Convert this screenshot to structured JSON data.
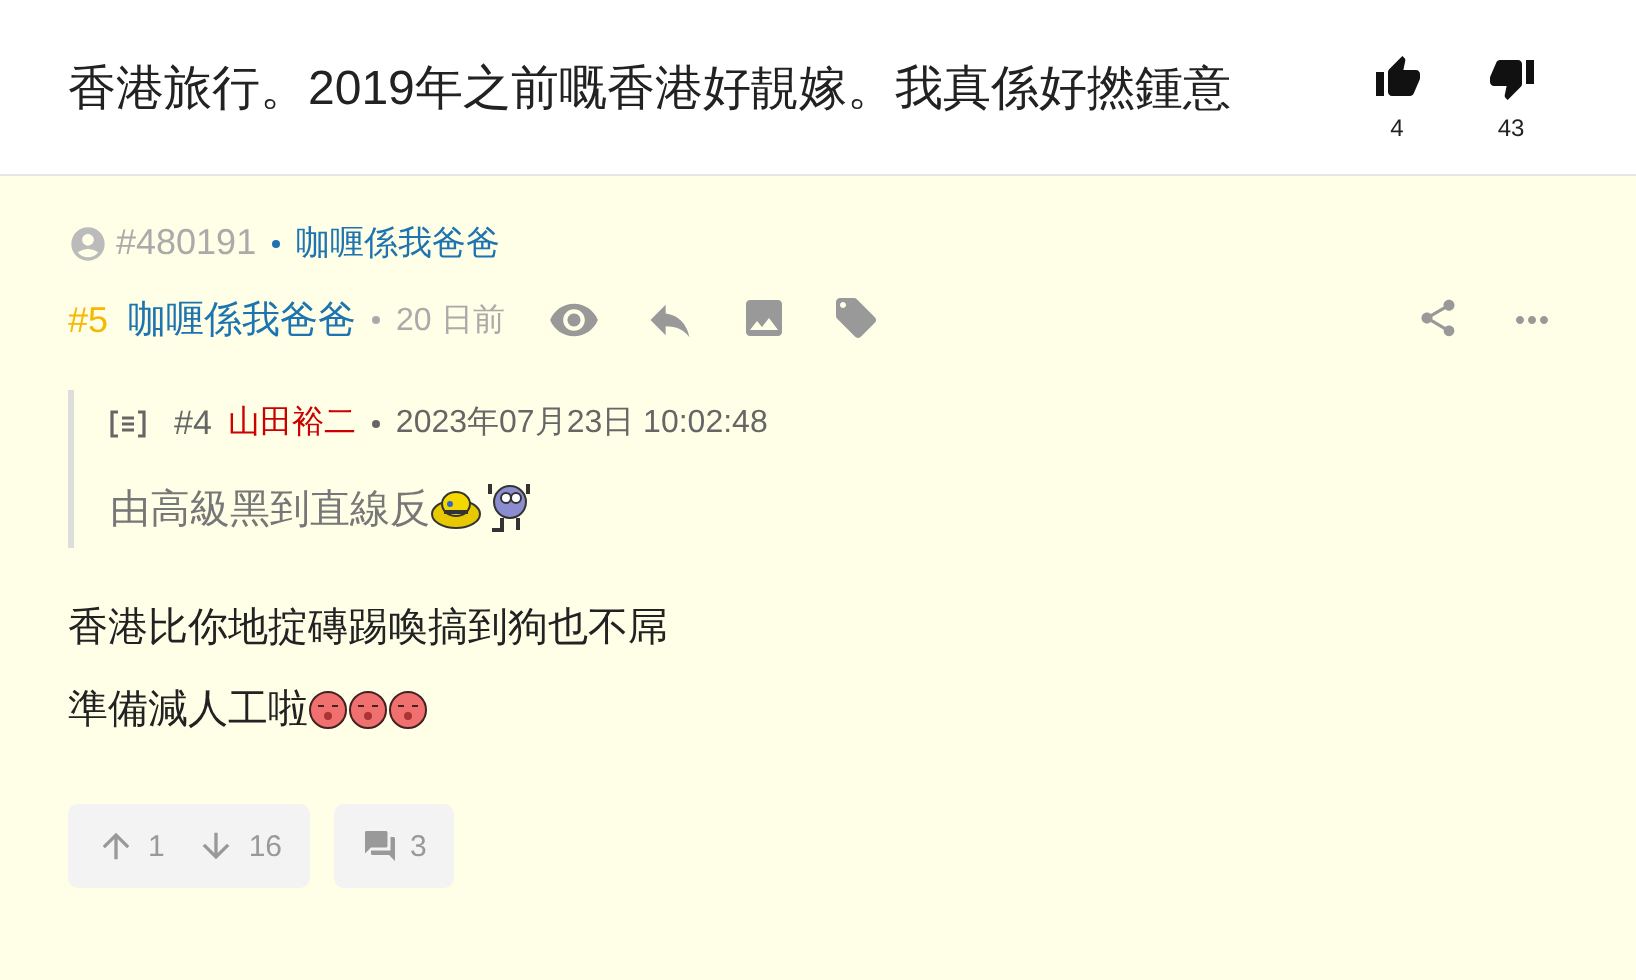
{
  "thread": {
    "title": "香港旅行。2019年之前嘅香港好靚嫁。我真係好撚鍾意",
    "likes": "4",
    "dislikes": "43"
  },
  "author_line": {
    "user_id": "#480191",
    "name": "咖喱係我爸爸"
  },
  "post": {
    "number": "#5",
    "author": "咖喱係我爸爸",
    "time": "20 日前",
    "quote": {
      "number": "#4",
      "author": "山田裕二",
      "time": "2023年07月23日 10:02:48",
      "text": "由高級黑到直線反",
      "emoji": [
        {
          "kind": "bell"
        },
        {
          "kind": "dancer"
        }
      ]
    },
    "lines": [
      {
        "text": "香港比你地掟磚踢喚搞到狗也不屌"
      },
      {
        "text": "準備減人工啦",
        "emoji": [
          {
            "kind": "blush"
          },
          {
            "kind": "blush"
          },
          {
            "kind": "blush"
          }
        ]
      }
    ],
    "upvotes": "1",
    "downvotes": "16",
    "replies": "3"
  }
}
